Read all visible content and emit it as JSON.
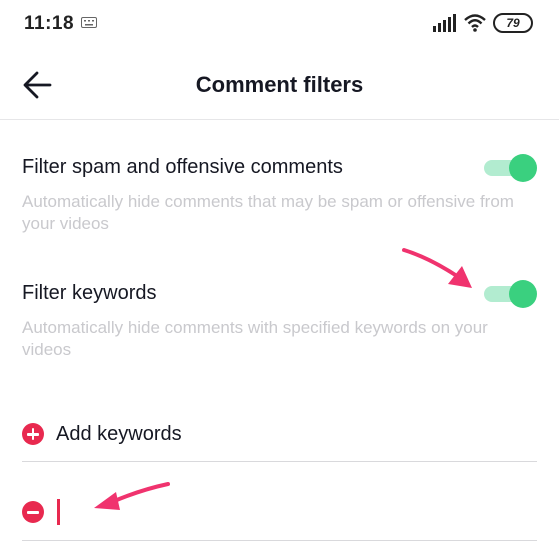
{
  "status_bar": {
    "time": "11:18",
    "battery": "79",
    "icons": [
      "keyboard-icon",
      "signal-icon",
      "wifi-icon",
      "battery-icon"
    ]
  },
  "header": {
    "title": "Comment filters",
    "back_icon": "arrow-left-icon"
  },
  "settings": [
    {
      "title": "Filter spam and offensive comments",
      "description": "Automatically hide comments that may be spam or offensive from your videos",
      "enabled": true
    },
    {
      "title": "Filter keywords",
      "description": "Automatically hide comments with specified keywords on your videos",
      "enabled": true
    }
  ],
  "keywords": {
    "add_label": "Add keywords",
    "add_icon": "plus-circle-icon",
    "remove_icon": "minus-circle-icon",
    "input_value": ""
  },
  "colors": {
    "accent": "#e8294f",
    "toggle_on": "#3ad07f",
    "toggle_track": "#b2ecd0",
    "annotation_arrow": "#f0336e"
  }
}
